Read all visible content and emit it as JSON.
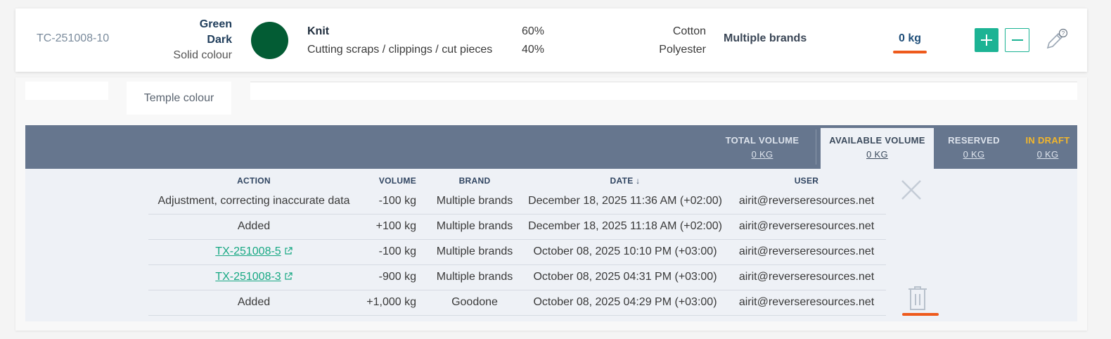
{
  "item": {
    "code": "TC-251008-10",
    "color_name": "Green",
    "color_shade": "Dark",
    "color_type": "Solid colour",
    "swatch_color": "#035c34",
    "material": "Knit",
    "subtype": "Cutting scraps / clippings / cut pieces",
    "percent_1": "60%",
    "percent_2": "40%",
    "fiber_1": "Cotton",
    "fiber_2": "Polyester",
    "brand": "Multiple brands",
    "weight": "0 kg",
    "plus_label": "+",
    "minus_label": "−",
    "help_label": "?"
  },
  "tabs": {
    "temple": "Temple colour"
  },
  "volumes": {
    "total_label": "TOTAL VOLUME",
    "total_value": "0 KG",
    "available_label": "AVAILABLE VOLUME",
    "available_value": "0 KG",
    "reserved_label": "RESERVED",
    "reserved_value": "0 KG",
    "draft_label": "IN DRAFT",
    "draft_value": "0 KG"
  },
  "table": {
    "headers": {
      "action": "ACTION",
      "volume": "VOLUME",
      "brand": "BRAND",
      "date": "DATE ↓",
      "user": "USER"
    },
    "rows": [
      {
        "action": "Adjustment, correcting inaccurate data",
        "volume": "-100 kg",
        "brand": "Multiple brands",
        "date": "December 18, 2025 11:36 AM (+02:00)",
        "user": "airit@reverseresources.net"
      },
      {
        "action": "Added",
        "volume": "+100 kg",
        "brand": "Multiple brands",
        "date": "December 18, 2025 11:18 AM (+02:00)",
        "user": "airit@reverseresources.net"
      },
      {
        "action": "TX-251008-5",
        "volume": "-100 kg",
        "brand": "Multiple brands",
        "date": "October 08, 2025 10:10 PM (+03:00)",
        "user": "airit@reverseresources.net"
      },
      {
        "action": "TX-251008-3",
        "volume": "-900 kg",
        "brand": "Multiple brands",
        "date": "October 08, 2025 04:31 PM (+03:00)",
        "user": "airit@reverseresources.net"
      },
      {
        "action": "Added",
        "volume": "+1,000 kg",
        "brand": "Goodone",
        "date": "October 08, 2025 04:29 PM (+03:00)",
        "user": "airit@reverseresources.net"
      }
    ]
  },
  "colors": {
    "accent": "#1cb394",
    "highlight": "#ee5a1c",
    "header_bg": "#66768e",
    "draft": "#f2b62c"
  }
}
